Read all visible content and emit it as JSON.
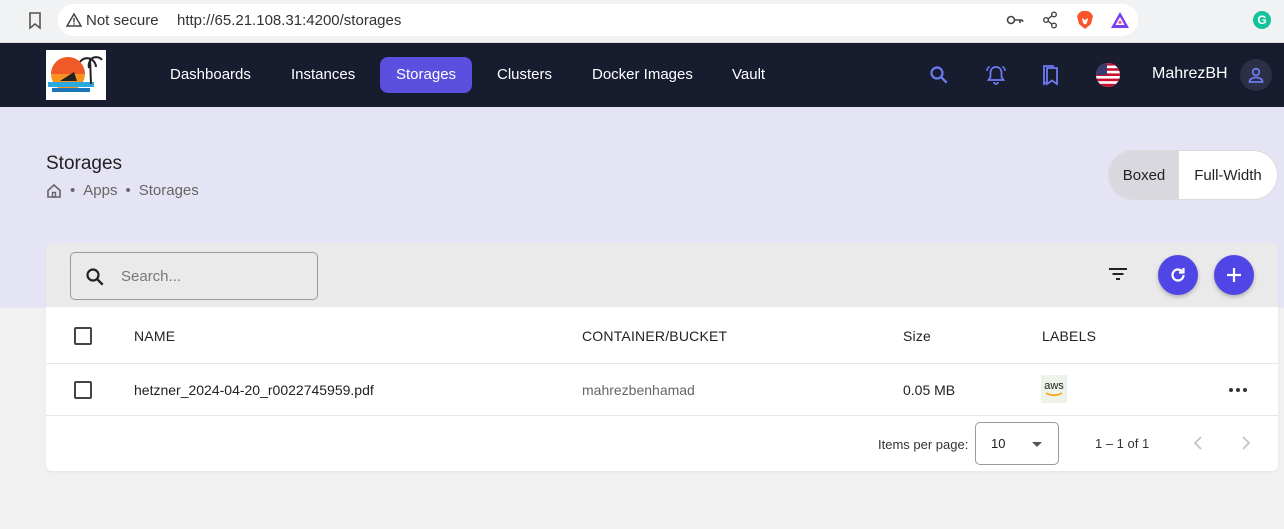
{
  "browser": {
    "security_label": "Not secure",
    "url": "http://65.21.108.31:4200/storages",
    "extension_initial": "G"
  },
  "header": {
    "nav": [
      {
        "label": "Dashboards",
        "active": false
      },
      {
        "label": "Instances",
        "active": false
      },
      {
        "label": "Storages",
        "active": true
      },
      {
        "label": "Clusters",
        "active": false
      },
      {
        "label": "Docker Images",
        "active": false
      },
      {
        "label": "Vault",
        "active": false
      }
    ],
    "username": "MahrezBH",
    "accent_color": "#5b4fe0",
    "background_color": "#171c2f"
  },
  "page": {
    "title": "Storages",
    "breadcrumb": [
      "Apps",
      "Storages"
    ],
    "layout_toggle": {
      "boxed": "Boxed",
      "full_width": "Full-Width",
      "selected": "Boxed"
    }
  },
  "toolbar": {
    "search_placeholder": "Search..."
  },
  "table": {
    "columns": [
      "NAME",
      "CONTAINER/BUCKET",
      "Size",
      "LABELS"
    ],
    "rows": [
      {
        "name": "hetzner_2024-04-20_r0022745959.pdf",
        "container": "mahrezbenhamad",
        "size": "0.05 MB",
        "label": "aws"
      }
    ]
  },
  "paginator": {
    "items_per_page_label": "Items per page:",
    "items_per_page": "10",
    "range": "1 – 1 of 1"
  },
  "icons": [
    "bookmark-icon",
    "warning-icon",
    "key-icon",
    "share-icon",
    "brave-icon",
    "triangle-extension-icon",
    "grammarly-icon",
    "search-icon",
    "bell-icon",
    "bookmarks-icon",
    "us-flag-icon",
    "user-icon",
    "home-icon",
    "filter-icon",
    "refresh-icon",
    "plus-icon",
    "more-icon",
    "chevron-left-icon",
    "chevron-right-icon"
  ]
}
